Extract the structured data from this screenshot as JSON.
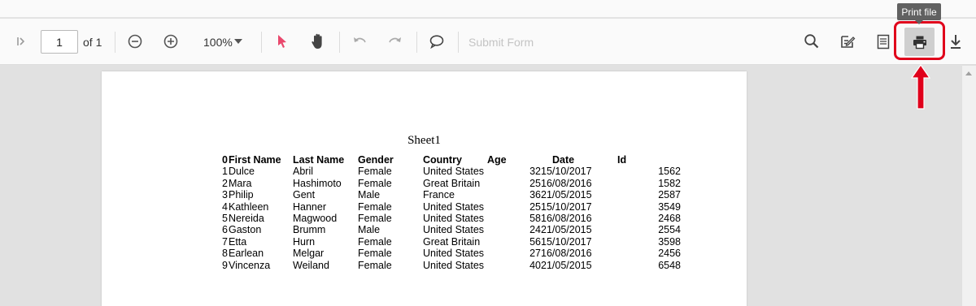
{
  "toolbar": {
    "page_number": "1",
    "page_of": "of 1",
    "zoom": "100%",
    "submit_form": "Submit Form"
  },
  "tooltip": {
    "text": "Print file"
  },
  "icons": {
    "first_page": "skip-to-start-icon",
    "zoom_out": "zoom-out-icon",
    "zoom_in": "zoom-in-icon",
    "zoom_dropdown": "chevron-down-icon",
    "select": "pointer-arrow-icon",
    "pan": "hand-icon",
    "undo": "undo-icon",
    "redo": "redo-icon",
    "comment": "comment-icon",
    "search": "search-icon",
    "annotate": "edit-annotation-icon",
    "form_designer": "form-icon",
    "print": "print-icon",
    "download": "download-icon"
  },
  "colors": {
    "select_tool": "#e9486d",
    "highlight": "#e0001b",
    "tooltip_bg": "#616161"
  },
  "document": {
    "title": "Sheet1",
    "headers": [
      "0",
      "First Name",
      "Last Name",
      "Gender",
      "Country",
      "Age",
      "Date",
      "Id"
    ],
    "rows": [
      [
        "1",
        "Dulce",
        "Abril",
        "Female",
        "United States",
        "32",
        "15/10/2017",
        "1562"
      ],
      [
        "2",
        "Mara",
        "Hashimoto",
        "Female",
        "Great Britain",
        "25",
        "16/08/2016",
        "1582"
      ],
      [
        "3",
        "Philip",
        "Gent",
        "Male",
        "France",
        "36",
        "21/05/2015",
        "2587"
      ],
      [
        "4",
        "Kathleen",
        "Hanner",
        "Female",
        "United States",
        "25",
        "15/10/2017",
        "3549"
      ],
      [
        "5",
        "Nereida",
        "Magwood",
        "Female",
        "United States",
        "58",
        "16/08/2016",
        "2468"
      ],
      [
        "6",
        "Gaston",
        "Brumm",
        "Male",
        "United States",
        "24",
        "21/05/2015",
        "2554"
      ],
      [
        "7",
        "Etta",
        "Hurn",
        "Female",
        "Great Britain",
        "56",
        "15/10/2017",
        "3598"
      ],
      [
        "8",
        "Earlean",
        "Melgar",
        "Female",
        "United States",
        "27",
        "16/08/2016",
        "2456"
      ],
      [
        "9",
        "Vincenza",
        "Weiland",
        "Female",
        "United States",
        "40",
        "21/05/2015",
        "6548"
      ]
    ]
  }
}
